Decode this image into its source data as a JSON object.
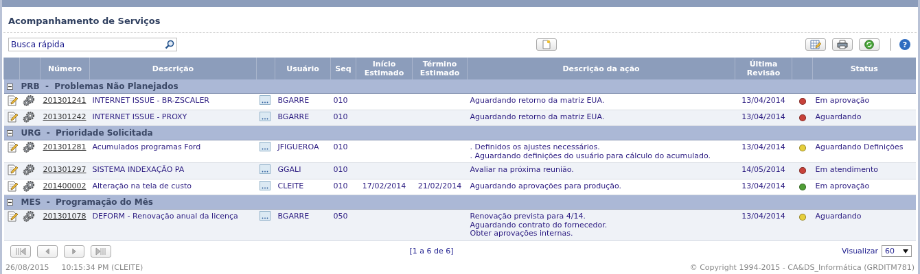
{
  "page": {
    "title": "Acompanhamento de Serviços"
  },
  "search": {
    "placeholder": "Busca rápida"
  },
  "help": {
    "label": "?"
  },
  "columns": [
    "Número",
    "Descrição",
    "Usuário",
    "Seq",
    "Início Estimado",
    "Término Estimado",
    "Descrição da ação",
    "Última Revisão",
    "Status"
  ],
  "groups": [
    {
      "label": "PRB  -  Problemas Não Planejados",
      "expanded": true,
      "rows": [
        {
          "number": "201301241",
          "description": "INTERNET ISSUE - BR-ZSCALER",
          "user": "BGARRE",
          "seq": "010",
          "action": [
            "Aguardando retorno da matriz EUA."
          ],
          "revision": "13/04/2014",
          "color": "#c8423a",
          "status": "Em aprovação"
        },
        {
          "number": "201301242",
          "description": "INTERNET ISSUE - PROXY",
          "user": "BGARRE",
          "seq": "010",
          "action": [
            "Aguardando retorno da matriz EUA."
          ],
          "revision": "13/04/2014",
          "color": "#c8423a",
          "status": "Aguardando"
        }
      ]
    },
    {
      "label": "URG  -  Prioridade Solicitada",
      "expanded": true,
      "rows": [
        {
          "number": "201301281",
          "description": "Acumulados programas Ford",
          "user": "JFIGUEROA",
          "seq": "010",
          "action": [
            ". Definidos os ajustes necessários.",
            ". Aguardando definições do usuário para cálculo do acumulado."
          ],
          "revision": "13/04/2014",
          "color": "#e6cf3c",
          "status": "Aguardando Definições"
        },
        {
          "number": "201301297",
          "description": "SISTEMA INDEXAÇÃO PA",
          "user": "GGALI",
          "seq": "010",
          "action": [
            "Avaliar na próxima reunião."
          ],
          "revision": "14/05/2014",
          "color": "#c8423a",
          "status": "Em atendimento"
        },
        {
          "number": "201400002",
          "description": "Alteração na tela de custo",
          "user": "CLEITE",
          "seq": "010",
          "start": "17/02/2014",
          "end": "21/02/2014",
          "action": [
            "Aguardando aprovações para produção."
          ],
          "revision": "13/04/2014",
          "color": "#4f9e35",
          "status": "Em aprovação"
        }
      ]
    },
    {
      "label": "MES  -  Programação do Mês",
      "expanded": true,
      "rows": [
        {
          "number": "201301078",
          "description": "DEFORM - Renovação anual da licença",
          "user": "BGARRE",
          "seq": "050",
          "action": [
            "Renovação prevista para 4/14.",
            "Aguardando contrato do fornecedor.",
            "Obter aprovações internas."
          ],
          "revision": "13/04/2014",
          "color": "#e6cf3c",
          "status": "Aguardando"
        }
      ]
    }
  ],
  "pager": {
    "info": "[1 a 6 de 6]",
    "view_label": "Visualizar",
    "page_size": "60"
  },
  "footer": {
    "date": "26/08/2015",
    "time": "10:15:34 PM (CLEITE)",
    "copyright": "© Copyright 1994-2015 - CA&DS_Informática (GRDITM781)"
  }
}
